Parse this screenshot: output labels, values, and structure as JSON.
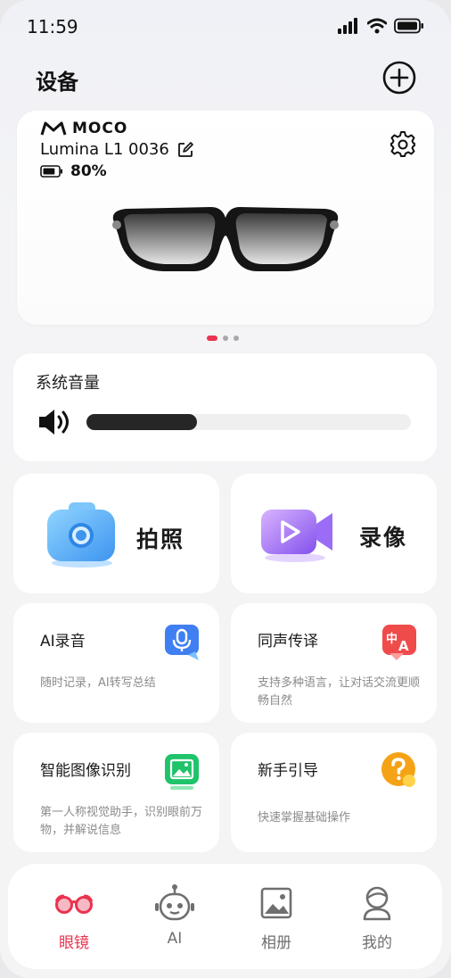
{
  "status_bar": {
    "time": "11:59"
  },
  "header": {
    "title": "设备"
  },
  "device": {
    "brand": "MOCO",
    "name": "Lumina L1 0036",
    "battery": "80%",
    "battery_level": 0.8,
    "page_count": 3,
    "active_page": 1
  },
  "volume": {
    "title": "系统音量",
    "level_percent": 34
  },
  "features": {
    "photo_label": "拍照",
    "video_label": "录像",
    "ai_recording": {
      "title": "AI录音",
      "desc": "随时记录，AI转写总结"
    },
    "translation": {
      "title": "同声传译",
      "desc": "支持多种语言，让对话交流更顺畅自然"
    },
    "image_recognition": {
      "title": "智能图像识别",
      "desc": "第一人称视觉助手，识别眼前万物，并解说信息"
    },
    "guide": {
      "title": "新手引导",
      "desc": "快速掌握基础操作"
    }
  },
  "nav": {
    "items": [
      {
        "label": "眼镜",
        "icon": "glasses-icon",
        "active": true
      },
      {
        "label": "AI",
        "icon": "robot-icon",
        "active": false
      },
      {
        "label": "相册",
        "icon": "gallery-icon",
        "active": false
      },
      {
        "label": "我的",
        "icon": "profile-icon",
        "active": false
      }
    ]
  },
  "colors": {
    "accent": "#e9334f",
    "camera_blue": "#4aa8f5",
    "video_purple": "#9b6cf5",
    "mic_blue": "#3f7ff2",
    "translate_red": "#f04b4b",
    "vision_green": "#1fc36a",
    "guide_orange": "#f5a316"
  }
}
